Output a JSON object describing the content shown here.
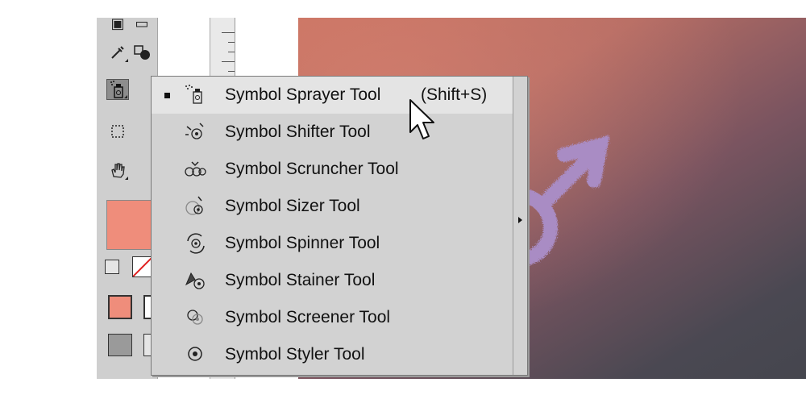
{
  "menu": {
    "items": [
      {
        "label": "Symbol Sprayer Tool",
        "shortcut": "(Shift+S)",
        "icon": "symbol-sprayer-icon",
        "selected": true
      },
      {
        "label": "Symbol Shifter Tool",
        "icon": "symbol-shifter-icon"
      },
      {
        "label": "Symbol Scruncher Tool",
        "icon": "symbol-scruncher-icon"
      },
      {
        "label": "Symbol Sizer Tool",
        "icon": "symbol-sizer-icon"
      },
      {
        "label": "Symbol Spinner Tool",
        "icon": "symbol-spinner-icon"
      },
      {
        "label": "Symbol Stainer Tool",
        "icon": "symbol-stainer-icon"
      },
      {
        "label": "Symbol Screener Tool",
        "icon": "symbol-screener-icon"
      },
      {
        "label": "Symbol Styler Tool",
        "icon": "symbol-styler-icon"
      }
    ]
  },
  "toolbar": {
    "tools": [
      "eyedropper-icon",
      "blend-icon",
      "symbol-sprayer-icon",
      "artboard-icon",
      "hand-icon"
    ],
    "fill_color": "#ef8d7b"
  },
  "canvas": {
    "symbol": "male-symbol",
    "symbol_color": "#a98cc4"
  }
}
